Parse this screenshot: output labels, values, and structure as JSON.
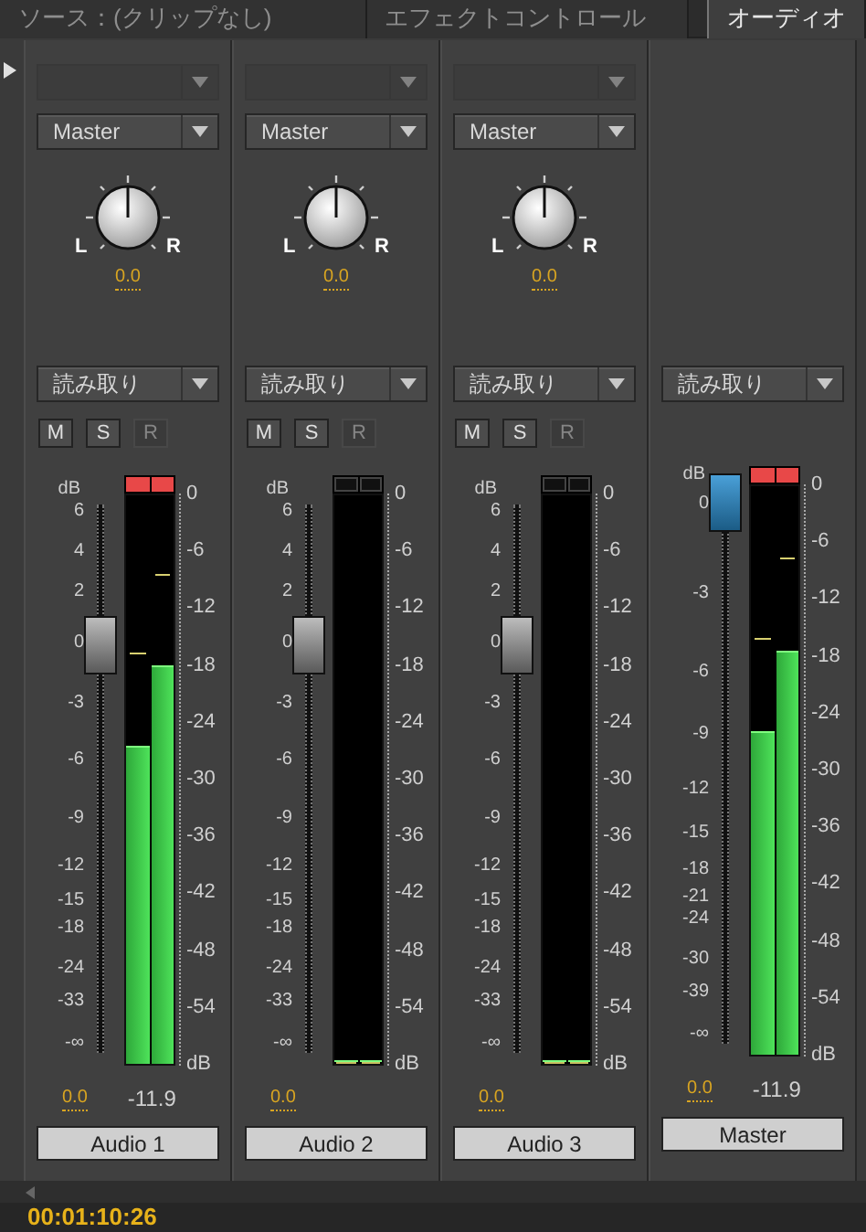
{
  "tabs": [
    {
      "label": "ソース：(クリップなし)",
      "selected": false
    },
    {
      "label": "エフェクトコントロール",
      "selected": false
    },
    {
      "label": "オーディオ",
      "selected": true
    }
  ],
  "channels": [
    {
      "kind": "track",
      "name": "Audio 1",
      "output": "Master",
      "pan": {
        "left": "L",
        "right": "R",
        "value": "0.0"
      },
      "automation": "読み取り",
      "buttons": [
        {
          "label": "M",
          "disabled": false
        },
        {
          "label": "S",
          "disabled": false
        },
        {
          "label": "R",
          "disabled": true
        }
      ],
      "fader": {
        "unit": "dB",
        "ticks": [
          "6",
          "4",
          "2",
          "0",
          "-3",
          "-6",
          "-9",
          "-12",
          "-15",
          "-18",
          "-24",
          "-33",
          "-∞"
        ],
        "level": 0.75
      },
      "meter": {
        "clip": true,
        "bars": [
          {
            "level": 0.56
          },
          {
            "level": 0.7
          }
        ],
        "scale": [
          "0",
          "-6",
          "-12",
          "-18",
          "-24",
          "-30",
          "-36",
          "-42",
          "-48",
          "-54",
          "dB"
        ]
      },
      "volume": "0.0",
      "peak": "-11.9"
    },
    {
      "kind": "track",
      "name": "Audio 2",
      "output": "Master",
      "pan": {
        "left": "L",
        "right": "R",
        "value": "0.0"
      },
      "automation": "読み取り",
      "buttons": [
        {
          "label": "M",
          "disabled": false
        },
        {
          "label": "S",
          "disabled": false
        },
        {
          "label": "R",
          "disabled": true
        }
      ],
      "fader": {
        "unit": "dB",
        "ticks": [
          "6",
          "4",
          "2",
          "0",
          "-3",
          "-6",
          "-9",
          "-12",
          "-15",
          "-18",
          "-24",
          "-33",
          "-∞"
        ],
        "level": 0.75
      },
      "meter": {
        "clip": false,
        "bars": [
          {
            "level": 0
          },
          {
            "level": 0
          }
        ],
        "scale": [
          "0",
          "-6",
          "-12",
          "-18",
          "-24",
          "-30",
          "-36",
          "-42",
          "-48",
          "-54",
          "dB"
        ]
      },
      "volume": "0.0"
    },
    {
      "kind": "track",
      "name": "Audio 3",
      "output": "Master",
      "pan": {
        "left": "L",
        "right": "R",
        "value": "0.0"
      },
      "automation": "読み取り",
      "buttons": [
        {
          "label": "M",
          "disabled": false
        },
        {
          "label": "S",
          "disabled": false
        },
        {
          "label": "R",
          "disabled": true
        }
      ],
      "fader": {
        "unit": "dB",
        "ticks": [
          "6",
          "4",
          "2",
          "0",
          "-3",
          "-6",
          "-9",
          "-12",
          "-15",
          "-18",
          "-24",
          "-33",
          "-∞"
        ],
        "level": 0.75
      },
      "meter": {
        "clip": false,
        "bars": [
          {
            "level": 0
          },
          {
            "level": 0
          }
        ],
        "scale": [
          "0",
          "-6",
          "-12",
          "-18",
          "-24",
          "-30",
          "-36",
          "-42",
          "-48",
          "-54",
          "dB"
        ]
      },
      "volume": "0.0"
    },
    {
      "kind": "master",
      "name": "Master",
      "automation": "読み取り",
      "fader": {
        "unit": "dB",
        "ticks": [
          "0",
          "-3",
          "-6",
          "-9",
          "-12",
          "-15",
          "-18",
          "-21",
          "-24",
          "-30",
          "-39",
          "-∞"
        ],
        "level": 1
      },
      "meter": {
        "clip": true,
        "bars": [
          {
            "level": 0.57
          },
          {
            "level": 0.71
          }
        ],
        "scale": [
          "0",
          "-6",
          "-12",
          "-18",
          "-24",
          "-30",
          "-36",
          "-42",
          "-48",
          "-54",
          "dB"
        ]
      },
      "volume": "0.0",
      "peak": "-11.9"
    }
  ],
  "timecode": "00:01:10:26"
}
